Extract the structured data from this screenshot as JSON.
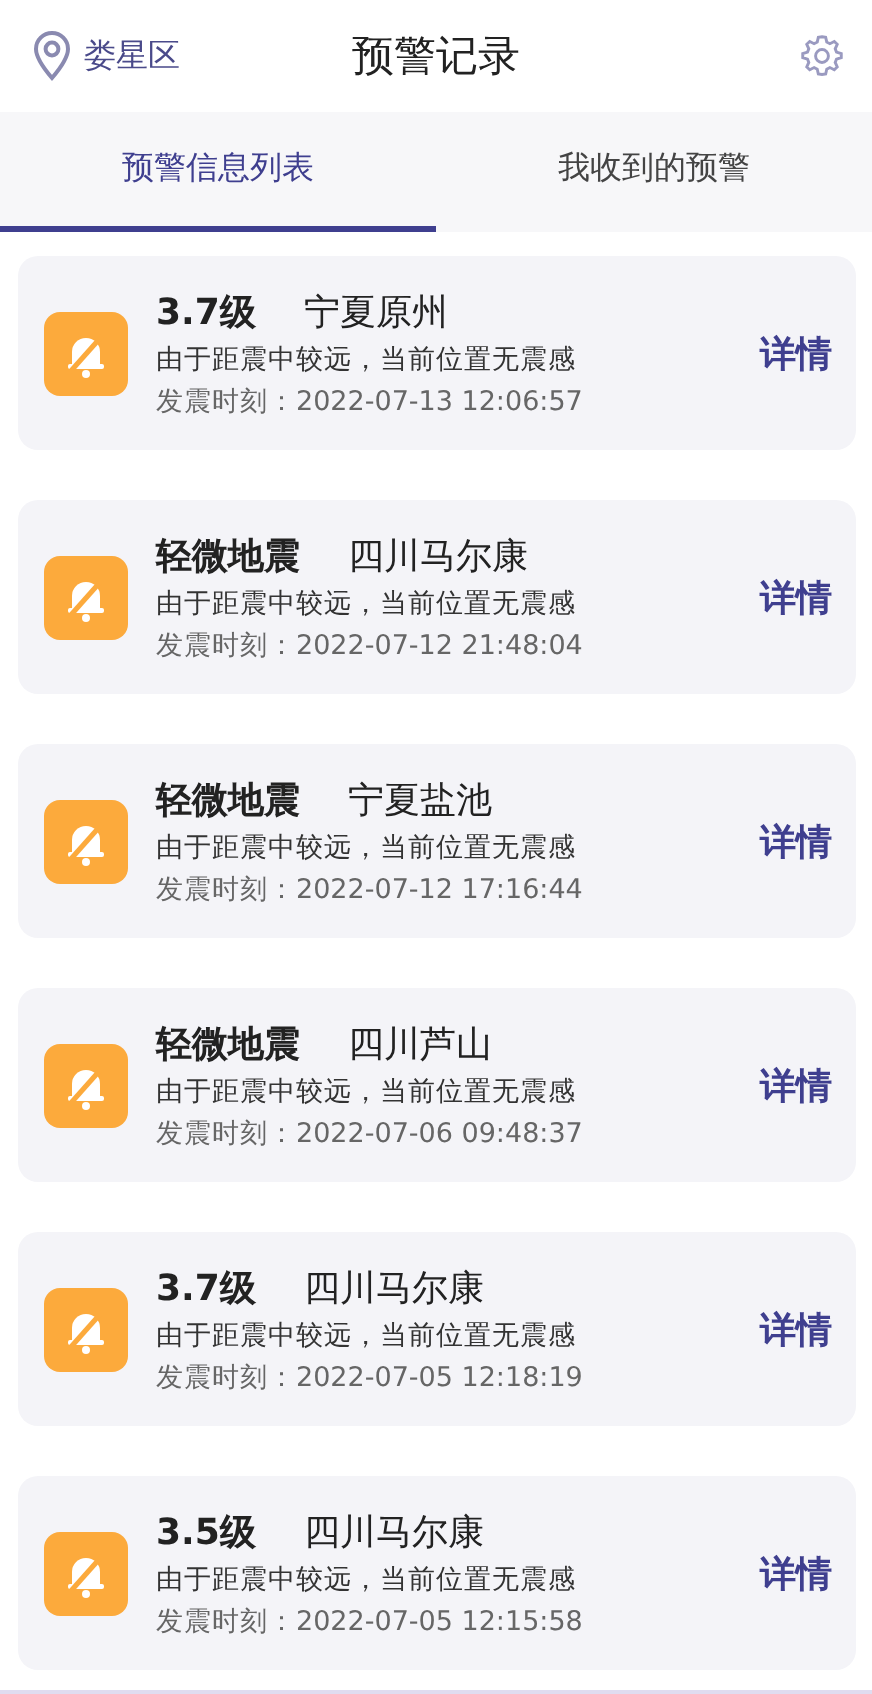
{
  "header": {
    "location": "娄星区",
    "title": "预警记录"
  },
  "tabs": [
    {
      "label": "预警信息列表",
      "selected": true
    },
    {
      "label": "我收到的预警",
      "selected": false
    }
  ],
  "records": [
    {
      "magnitude": "3.7级",
      "place": "宁夏原州",
      "note": "由于距震中较远，当前位置无震感",
      "time": "发震时刻：2022-07-13 12:06:57",
      "action": "详情"
    },
    {
      "magnitude": "轻微地震",
      "place": "四川马尔康",
      "note": "由于距震中较远，当前位置无震感",
      "time": "发震时刻：2022-07-12 21:48:04",
      "action": "详情"
    },
    {
      "magnitude": "轻微地震",
      "place": "宁夏盐池",
      "note": "由于距震中较远，当前位置无震感",
      "time": "发震时刻：2022-07-12 17:16:44",
      "action": "详情"
    },
    {
      "magnitude": "轻微地震",
      "place": "四川芦山",
      "note": "由于距震中较远，当前位置无震感",
      "time": "发震时刻：2022-07-06 09:48:37",
      "action": "详情"
    },
    {
      "magnitude": "3.7级",
      "place": "四川马尔康",
      "note": "由于距震中较远，当前位置无震感",
      "time": "发震时刻：2022-07-05 12:18:19",
      "action": "详情"
    },
    {
      "magnitude": "3.5级",
      "place": "四川马尔康",
      "note": "由于距震中较远，当前位置无震感",
      "time": "发震时刻：2022-07-05 12:15:58",
      "action": "详情"
    }
  ]
}
